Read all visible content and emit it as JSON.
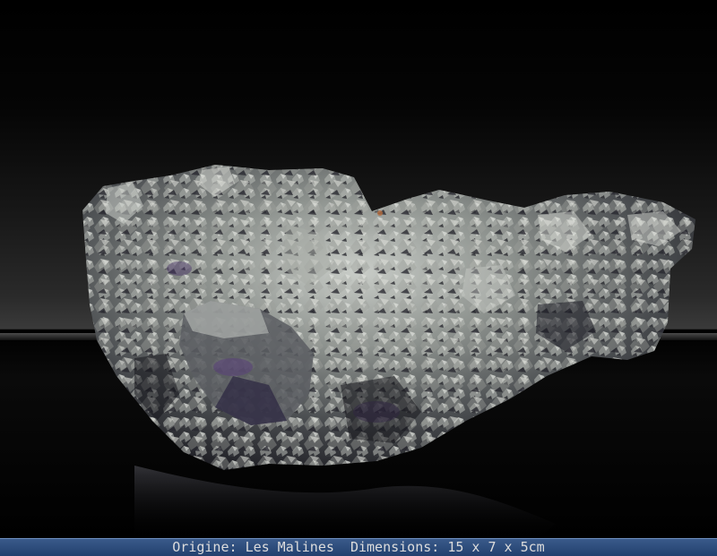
{
  "caption": {
    "origin_label": "Origine:",
    "origin_value": "Les Malines",
    "dimensions_label": "Dimensions:",
    "dimensions_value": "15 x 7 x 5cm"
  },
  "colors": {
    "background": "#000000",
    "caption_bar": "#2c4b7c",
    "caption_text": "#dcdcdc",
    "specimen_metal": "#8f9490",
    "specimen_shadow": "#1c1c24",
    "specimen_purple": "#5a3f7a"
  }
}
